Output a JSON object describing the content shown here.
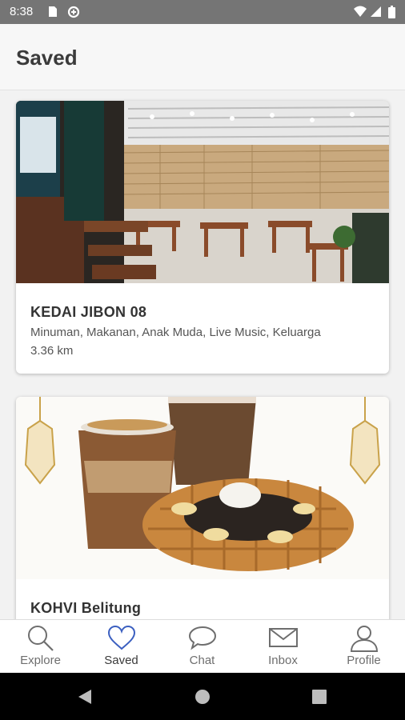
{
  "status_bar": {
    "time": "8:38",
    "icons": [
      "sim-card-icon",
      "data-saver-icon",
      "wifi-icon",
      "signal-icon",
      "battery-icon"
    ]
  },
  "header": {
    "title": "Saved"
  },
  "saved_places": [
    {
      "name": "KEDAI JIBON 08",
      "categories": "Minuman, Makanan, Anak Muda, Live Music, Keluarga",
      "distance": "3.36 km",
      "image": "cafe-interior-photo"
    },
    {
      "name": "KOHVI Belitung",
      "image": "iced-coffee-and-waffle-photo"
    }
  ],
  "bottom_nav": [
    {
      "label": "Explore",
      "icon": "search-icon"
    },
    {
      "label": "Saved",
      "icon": "heart-icon",
      "active": true
    },
    {
      "label": "Chat",
      "icon": "chat-bubble-icon"
    },
    {
      "label": "Inbox",
      "icon": "envelope-icon"
    },
    {
      "label": "Profile",
      "icon": "person-icon"
    }
  ],
  "colors": {
    "accent": "#3b5fc0",
    "status_bar": "#757575",
    "nav_inactive": "#6e6e6e"
  }
}
